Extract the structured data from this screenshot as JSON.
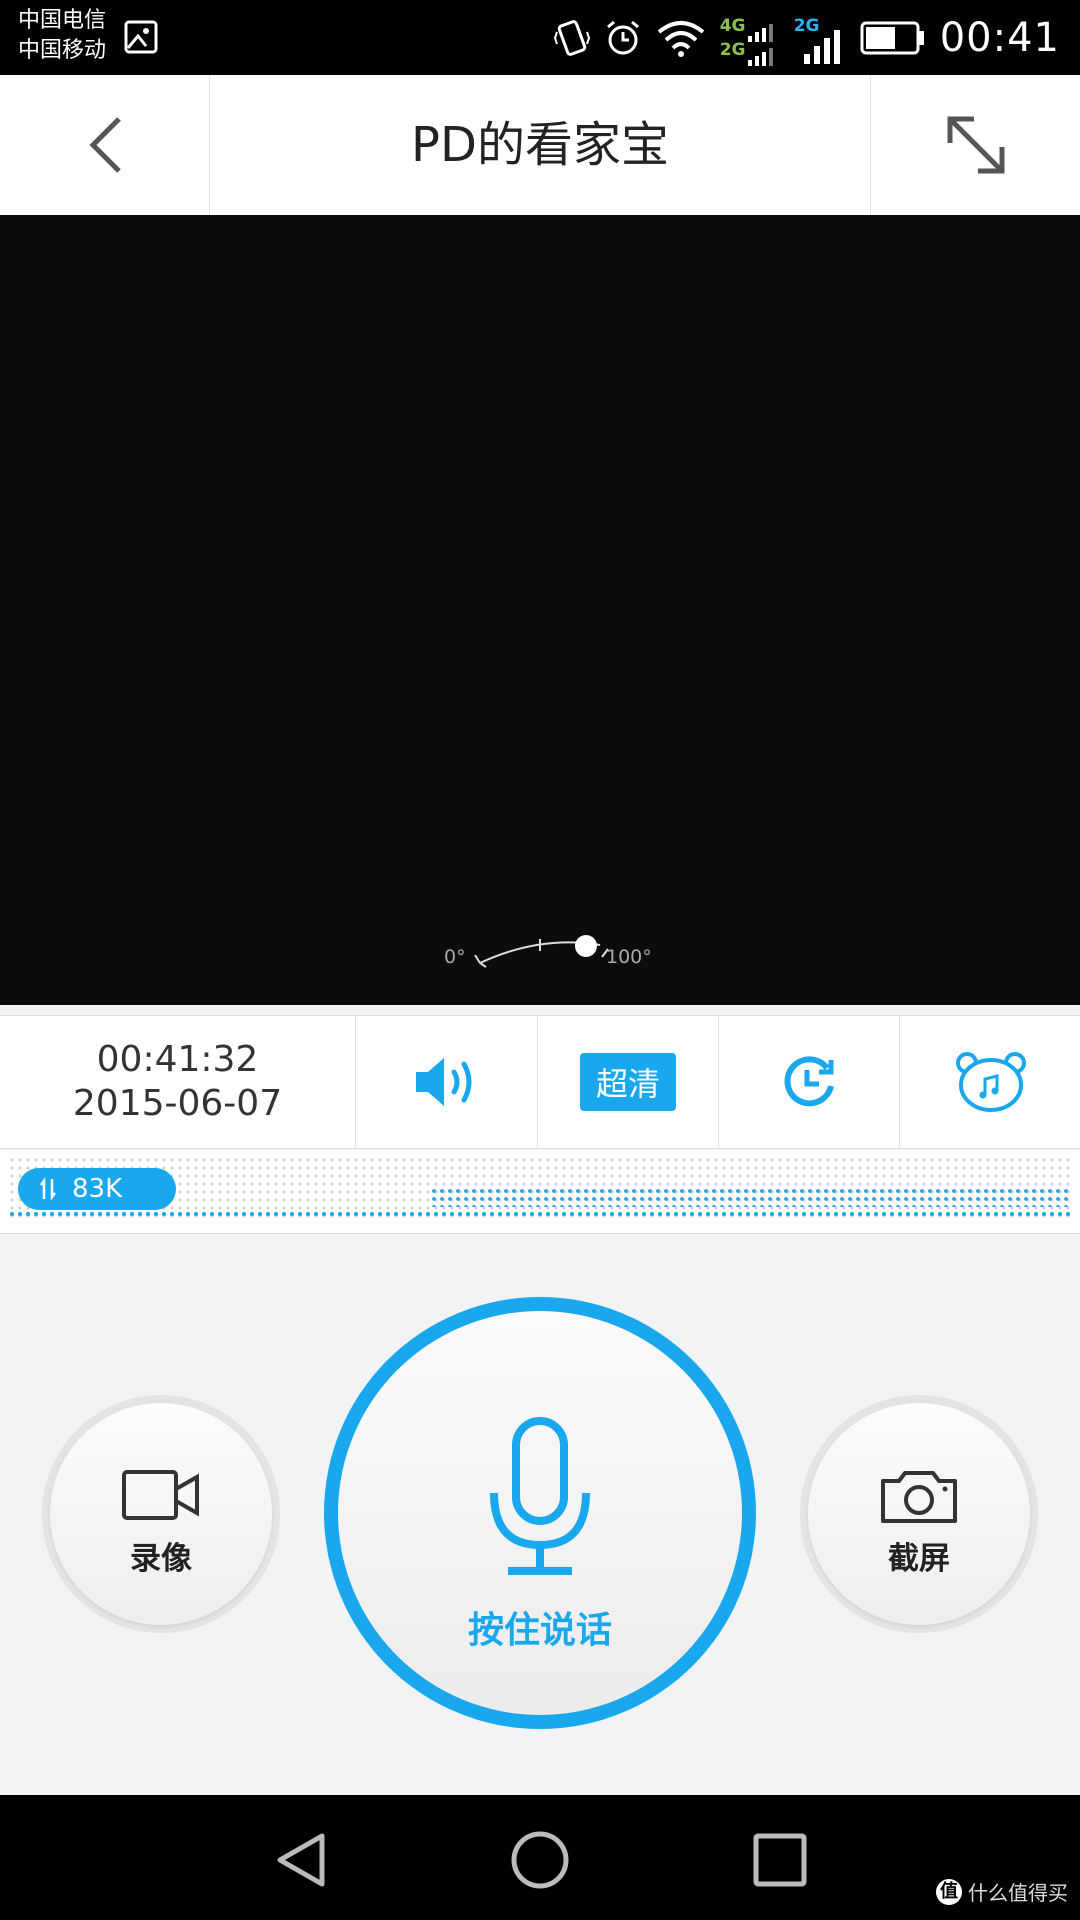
{
  "status_bar": {
    "carrier_1": "中国电信",
    "carrier_2": "中国移动",
    "net_1": "4G",
    "net_2": "2G",
    "net_3": "2G",
    "time": "00:41",
    "battery_level": 0.6
  },
  "header": {
    "title": "PD的看家宝"
  },
  "video": {
    "angle_min": "0°",
    "angle_max": "100°",
    "angle_value": 1.0
  },
  "controls": {
    "time": "00:41:32",
    "date": "2015-06-07",
    "quality_label": "超清"
  },
  "bitrate": {
    "value": "83K"
  },
  "actions": {
    "record_label": "录像",
    "talk_label": "按住说话",
    "screenshot_label": "截屏"
  },
  "watermark": {
    "logo_char": "值",
    "text": "什么值得买"
  },
  "colors": {
    "accent": "#19a8ee",
    "background": "#f2f3f5"
  }
}
